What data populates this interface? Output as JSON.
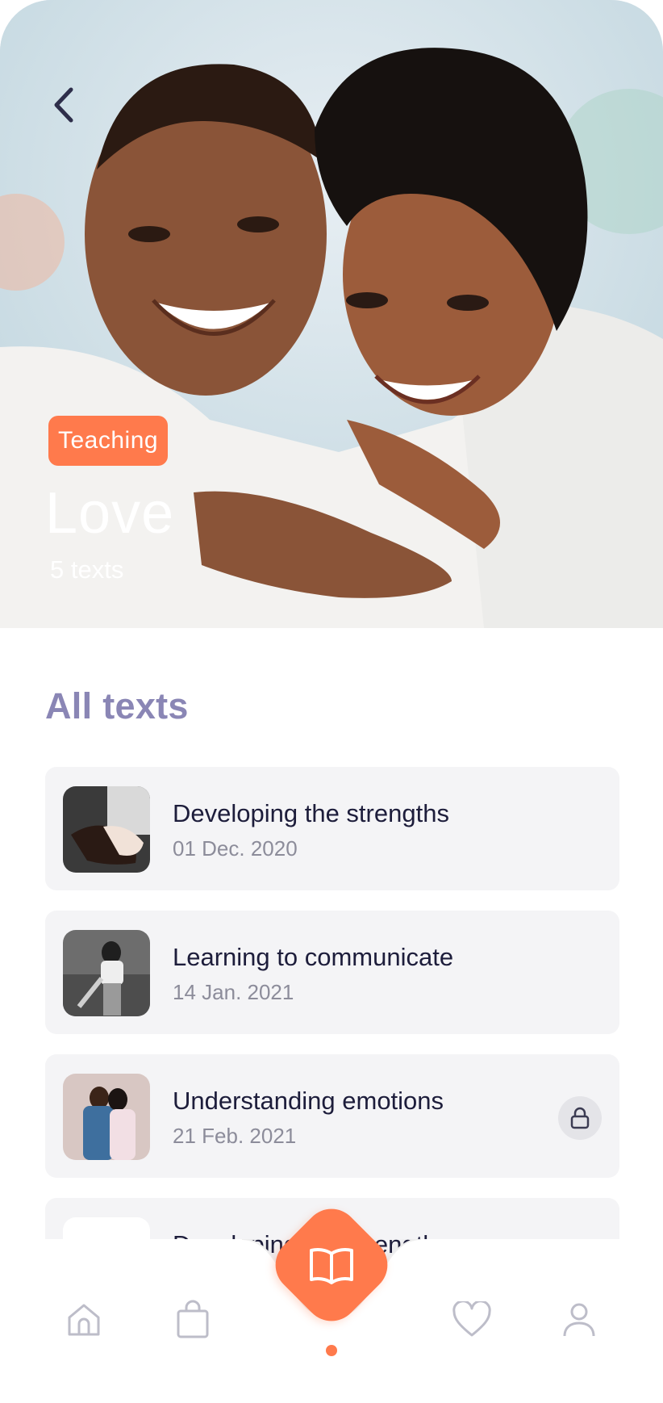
{
  "hero": {
    "category": "Teaching",
    "title": "Love",
    "count": "5 texts",
    "back_icon": "chevron-left-icon"
  },
  "section": {
    "title": "All texts"
  },
  "items": [
    {
      "title": "Developing the strengths",
      "date": "01 Dec. 2020",
      "locked": false
    },
    {
      "title": "Learning to communicate",
      "date": "14 Jan. 2021",
      "locked": false
    },
    {
      "title": "Understanding emotions",
      "date": "21 Feb. 2021",
      "locked": true
    },
    {
      "title": "Developing the strengths",
      "date": "",
      "locked": false
    }
  ],
  "nav": {
    "items": [
      "home-icon",
      "bag-icon",
      "book-icon",
      "heart-icon",
      "user-icon"
    ],
    "active": "book-icon"
  },
  "colors": {
    "accent": "#ff7a4c",
    "section_title": "#8a86b5",
    "text_dark": "#1d1d3b",
    "text_muted": "#8c8c9a",
    "card_bg": "#f4f4f6",
    "icon_gray": "#bdbdc9"
  }
}
